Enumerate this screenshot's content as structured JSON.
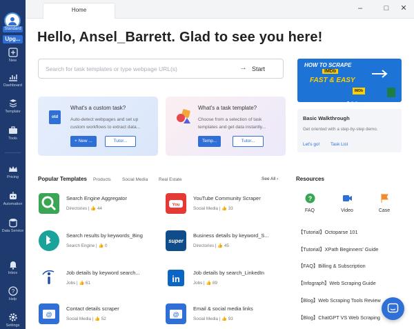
{
  "sidebar": {
    "plan_badge": "Standard",
    "upgrade_label": "Upg...",
    "items": [
      {
        "label": "New",
        "icon": "plus-icon"
      },
      {
        "label": "Dashboard",
        "icon": "dashboard-icon"
      },
      {
        "label": "Template",
        "icon": "template-icon"
      },
      {
        "label": "Tools",
        "icon": "toolbox-icon"
      },
      {
        "label": "Pricing",
        "icon": "crown-icon"
      },
      {
        "label": "Automation",
        "icon": "robot-icon"
      },
      {
        "label": "Data Service",
        "icon": "data-service-icon"
      },
      {
        "label": "Inbox",
        "icon": "bell-icon"
      },
      {
        "label": "Help",
        "icon": "help-icon"
      },
      {
        "label": "Settings",
        "icon": "gear-icon"
      }
    ]
  },
  "tabs": {
    "home": "Home"
  },
  "greeting": "Hello, Ansel_Barrett. Glad to see you here!",
  "search": {
    "placeholder": "Search for task templates or type webpage URL(s)",
    "start_label": "Start"
  },
  "cards": {
    "custom": {
      "title": "What's a custom task?",
      "description": "Auto-detect webpages and set up custom workflows to extract data...",
      "primary": "+ New ...",
      "secondary": "Tutor...",
      "icon_text": "otd"
    },
    "template": {
      "title": "What's a task template?",
      "description": "Choose from a selection of task templates and get data instantly...",
      "primary": "Temp...",
      "secondary": "Tutor..."
    }
  },
  "promo": {
    "line1": "HOW TO SCRAPE",
    "line2": "IMDb",
    "line3": "FAST & EASY"
  },
  "walkthrough": {
    "title": "Basic Walkthrough",
    "description": "Get oriented with a step-by-step demo.",
    "link1": "Let's go!",
    "link2": "Task List"
  },
  "popular": {
    "heading": "Popular Templates",
    "tabs": [
      "Products",
      "Social Media",
      "Real Estate"
    ],
    "see_all": "See All",
    "templates": [
      {
        "name": "Search Engine Aggregator",
        "category": "Directories",
        "likes": "44",
        "icon": "magnifier-icon",
        "color": "#3aa655"
      },
      {
        "name": "YouTube Community Scraper",
        "category": "Social Media",
        "likes": "33",
        "icon": "youtube-icon",
        "color": "#e53935"
      },
      {
        "name": "Search results by keywords_Bing",
        "category": "Search Engine",
        "likes": "0",
        "icon": "bing-icon",
        "color": "#1aa39a"
      },
      {
        "name": "Business details by keyword_S...",
        "category": "Directories",
        "likes": "45",
        "icon": "super-icon",
        "color": "#0f4c8a"
      },
      {
        "name": "Job details by keyword search...",
        "category": "Jobs",
        "likes": "61",
        "icon": "indeed-icon",
        "color": "#ffffff"
      },
      {
        "name": "Job details by search_LinkedIn",
        "category": "Jobs",
        "likes": "89",
        "icon": "linkedin-icon",
        "color": "#ffffff"
      },
      {
        "name": "Contact details scraper",
        "category": "Social Media",
        "likes": "52",
        "icon": "email-icon",
        "color": "#2f6fd6"
      },
      {
        "name": "Email & social media links",
        "category": "Social Media",
        "likes": "93",
        "icon": "email-icon",
        "color": "#2f6fd6"
      }
    ]
  },
  "resources": {
    "heading": "Resources",
    "icons": [
      {
        "label": "FAQ",
        "icon": "faq-icon",
        "color": "#3aa655"
      },
      {
        "label": "Video",
        "icon": "video-icon",
        "color": "#2f6fd6"
      },
      {
        "label": "Case",
        "icon": "case-icon",
        "color": "#f28c28"
      }
    ],
    "links": [
      "【Tutorial】Octoparse 101",
      "【Tutorial】XPath Beginners' Guide",
      "【FAQ】Billing & Subscription",
      "【Infograph】Web Scraping Guide",
      "【Blog】Web Scraping Tools Review",
      "【Blog】ChatGPT VS Web Scraping"
    ]
  },
  "colors": {
    "sidebar": "#1e3a6e",
    "accent": "#2f6fd6"
  }
}
